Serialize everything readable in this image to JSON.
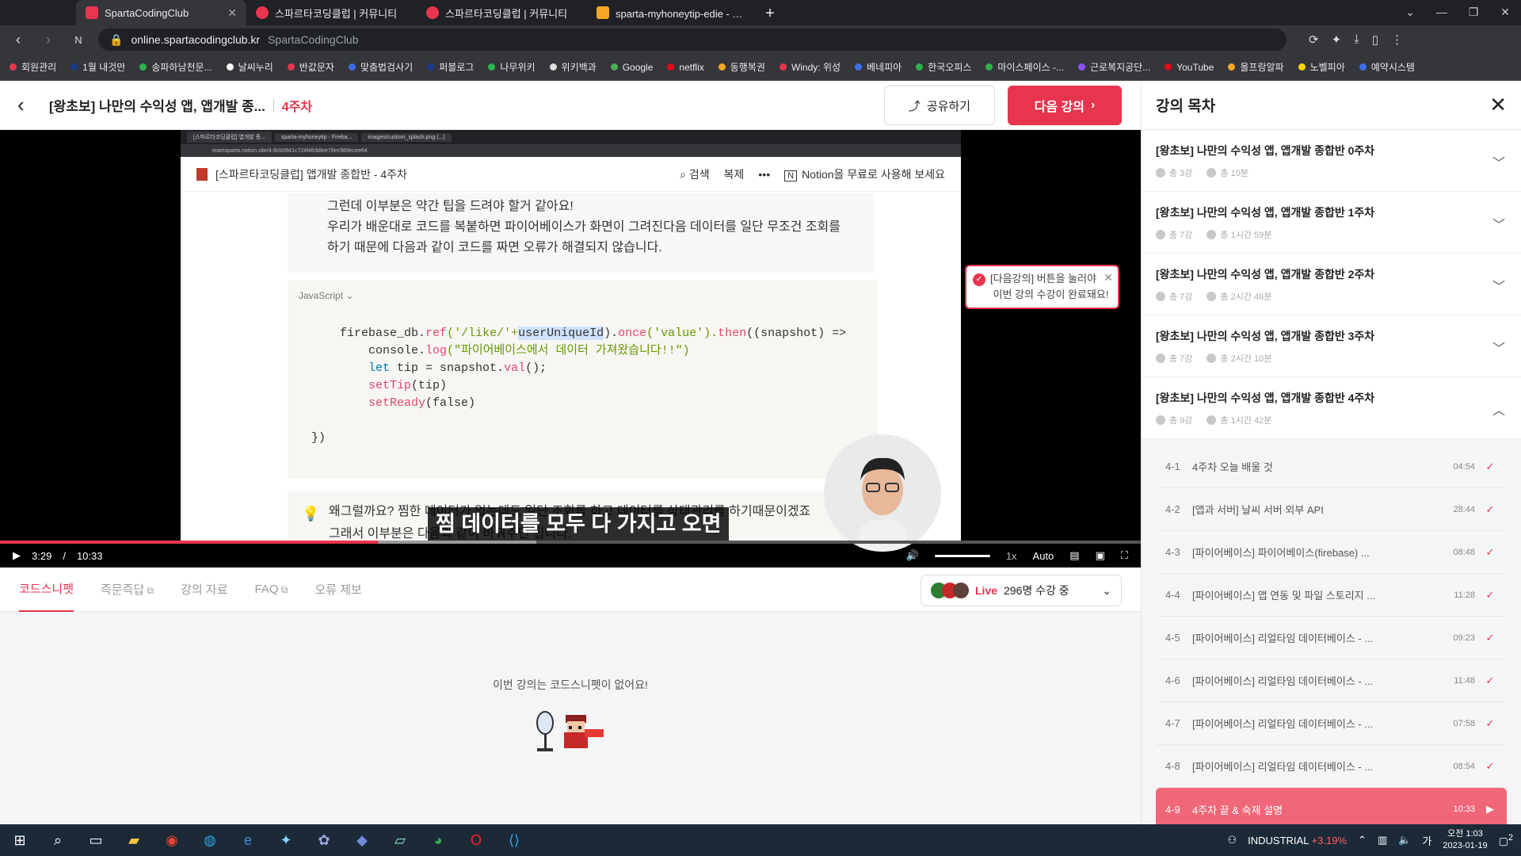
{
  "browser": {
    "tabs": [
      {
        "label": "SpartaCodingClub",
        "color": "#e8344e"
      },
      {
        "label": "스파르타코딩클럽 | 커뮤니티",
        "color": "#e8344e"
      },
      {
        "label": "스파르타코딩클럽 | 커뮤니티",
        "color": "#e8344e"
      },
      {
        "label": "sparta-myhoneytip-edie - 실시간",
        "color": "#f5a623"
      }
    ],
    "url": "online.spartacodingclub.kr",
    "url_site": "SpartaCodingClub",
    "bookmarks": [
      {
        "label": "회원관리",
        "color": "#e8344e"
      },
      {
        "label": "1월 내것만",
        "color": "#1a3b8a"
      },
      {
        "label": "송파하남천문...",
        "color": "#2db34a"
      },
      {
        "label": "날씨누리",
        "color": "#ffffff"
      },
      {
        "label": "반값문자",
        "color": "#e8344e"
      },
      {
        "label": "맞춤법검사기",
        "color": "#3b6ee8"
      },
      {
        "label": "퍼블로그",
        "color": "#1a3b8a"
      },
      {
        "label": "나무위키",
        "color": "#2db34a"
      },
      {
        "label": "위키백과",
        "color": "#dddddd"
      },
      {
        "label": "Google",
        "color": "#4caf50"
      },
      {
        "label": "netflix",
        "color": "#e50914"
      },
      {
        "label": "동행복권",
        "color": "#f5a623"
      },
      {
        "label": "Windy: 위성",
        "color": "#e8344e"
      },
      {
        "label": "베네피아",
        "color": "#3b6ee8"
      },
      {
        "label": "한국오피스",
        "color": "#2db34a"
      },
      {
        "label": "마이스페이스 -...",
        "color": "#2db34a"
      },
      {
        "label": "근로복지공단...",
        "color": "#8a4fff"
      },
      {
        "label": "YouTube",
        "color": "#e50914"
      },
      {
        "label": "올프람알파",
        "color": "#f5a623"
      },
      {
        "label": "노벨피아",
        "color": "#ffd400"
      },
      {
        "label": "예약시스템",
        "color": "#3b6ee8"
      }
    ]
  },
  "header": {
    "lecture_title": "[왕초보] 나만의 수익성 앱, 앱개발 종...",
    "week": "4주차",
    "share_label": "공유하기",
    "next_label": "다음 강의"
  },
  "video": {
    "inner_tabs": [
      "[스파르타코딩클럽] 앱개발 종...",
      "sparta-myhoneytip - Fireba...",
      "images/custom_splash.png (...)"
    ],
    "inner_url": "teamsparta.notion.site/4-8cb0841c724f4fcb8ee78ec989ecee64",
    "notion_title": "[스파르타코딩클럽] 앱개발 종합반 - 4주차",
    "notion_search": "검색",
    "notion_copy": "복제",
    "notion_cta": "Notion을 무료로 사용해 보세요",
    "text_line1": "그런데 이부분은 약간 팁을 드려야 할거 같아요!",
    "text_line2": "우리가 배운대로 코드를 복붙하면 파이어베이스가 화면이 그려진다음 데이터를 일단 무조건 조회를",
    "text_line3": "하기 때문에 다음과 같이 코드를 짜면 오류가 해결되지 않습니다.",
    "code_lang": "JavaScript",
    "code_l1a": "firebase_db.",
    "code_l1b": "ref",
    "code_l1c": "('/like/'+",
    "code_l1d": "userUniqueId",
    "code_l1e": ").",
    "code_l1f": "once",
    "code_l1g": "('value').",
    "code_l1h": "then",
    "code_l1i": "((snapshot) =>",
    "code_l2a": "console.",
    "code_l2b": "log",
    "code_l2c": "(\"파이어베이스에서 데이터 가져왔습니다!!\")",
    "code_l3a": "let",
    "code_l3b": " tip = snapshot.",
    "code_l3c": "val",
    "code_l3d": "();",
    "code_l4a": "setTip",
    "code_l4b": "(tip)",
    "code_l5a": "setReady",
    "code_l5b": "(false)",
    "code_l6": "})",
    "callout_l1": "왜그럴까요? 찜한 데이터가 없는데도 일단 조회를 하고 데이터를 상태관리를 하기때문이겠죠",
    "callout_l2": "그래서 이부분은 다음과 같이 바꿔주면 됩니다.",
    "subtitle": "찜 데이터를 모두 다 가지고 오면",
    "toast_line1": "[다음강의] 버튼을 눌러야",
    "toast_line2": "이번 강의 수강이 완료돼요!",
    "current_time": "3:29",
    "time_sep": "/",
    "duration": "10:33",
    "played_fraction": 0.331,
    "buffered_fraction": 0.47,
    "speed": "1x",
    "quality": "Auto"
  },
  "below": {
    "tabs": [
      {
        "label": "코드스니펫",
        "active": true,
        "ext": false
      },
      {
        "label": "즉문즉답",
        "active": false,
        "ext": true
      },
      {
        "label": "강의 자료",
        "active": false,
        "ext": false
      },
      {
        "label": "FAQ",
        "active": false,
        "ext": true
      },
      {
        "label": "오류 제보",
        "active": false,
        "ext": false
      }
    ],
    "live_label": "Live",
    "live_count": "296명 수강 중",
    "empty_text": "이번 강의는 코드스니펫이 없어요!"
  },
  "sidebar": {
    "title": "강의 목차",
    "weeks": [
      {
        "title": "[왕초보] 나만의 수익성 앱, 앱개발 종합반 0주차",
        "count": "총 3강",
        "time": "총 10분",
        "open": false
      },
      {
        "title": "[왕초보] 나만의 수익성 앱, 앱개발 종합반 1주차",
        "count": "총 7강",
        "time": "총 1시간 59분",
        "open": false
      },
      {
        "title": "[왕초보] 나만의 수익성 앱, 앱개발 종합반 2주차",
        "count": "총 7강",
        "time": "총 2시간 48분",
        "open": false
      },
      {
        "title": "[왕초보] 나만의 수익성 앱, 앱개발 종합반 3주차",
        "count": "총 7강",
        "time": "총 2시간 10분",
        "open": false
      },
      {
        "title": "[왕초보] 나만의 수익성 앱, 앱개발 종합반 4주차",
        "count": "총 9강",
        "time": "총 1시간 42분",
        "open": true
      }
    ],
    "lessons": [
      {
        "num": "4-1",
        "title": "4주차 오늘 배울 것",
        "dur": "04:54",
        "current": false
      },
      {
        "num": "4-2",
        "title": "[앱과 서버] 날씨 서버 외부 API",
        "dur": "28:44",
        "current": false
      },
      {
        "num": "4-3",
        "title": "[파이어베이스] 파이어베이스(firebase) ...",
        "dur": "08:48",
        "current": false
      },
      {
        "num": "4-4",
        "title": "[파이어베이스] 앱 연동 및 파일 스토리지 ...",
        "dur": "11:28",
        "current": false
      },
      {
        "num": "4-5",
        "title": "[파이어베이스] 리얼타임 데이터베이스 - ...",
        "dur": "09:23",
        "current": false
      },
      {
        "num": "4-6",
        "title": "[파이어베이스] 리얼타임 데이터베이스 - ...",
        "dur": "11:48",
        "current": false
      },
      {
        "num": "4-7",
        "title": "[파이어베이스] 리얼타임 데이터베이스 - ...",
        "dur": "07:58",
        "current": false
      },
      {
        "num": "4-8",
        "title": "[파이어베이스] 리얼타임 데이터베이스 - ...",
        "dur": "08:54",
        "current": false
      },
      {
        "num": "4-9",
        "title": "4주차 끝 & 숙제 설명",
        "dur": "10:33",
        "current": true
      }
    ]
  },
  "taskbar": {
    "stock_name": "INDUSTRIAL",
    "stock_change": "+3.19%",
    "time": "오전 1:03",
    "date": "2023-01-19",
    "notif": "2"
  }
}
